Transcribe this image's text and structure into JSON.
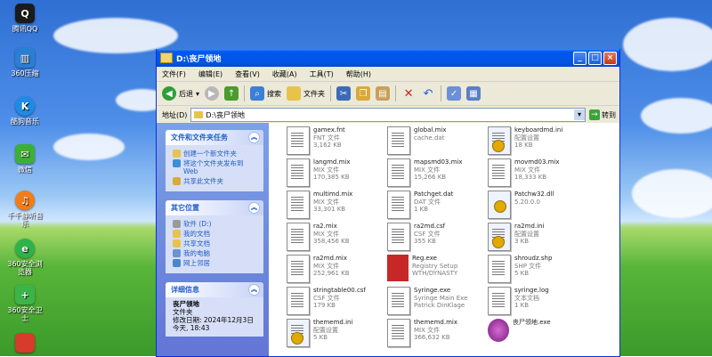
{
  "desktop": {
    "icons": [
      {
        "label": "腾讯QQ",
        "icon": "qq-icon",
        "color": "#1b1b1b"
      },
      {
        "label": "360压缩",
        "icon": "archive-icon",
        "color": "#2a7fd4"
      },
      {
        "label": "酷狗音乐",
        "icon": "music-icon",
        "color": "#1e8be6"
      },
      {
        "label": "微信",
        "icon": "wechat-icon",
        "color": "#3cb034"
      },
      {
        "label": "千千静听音乐",
        "icon": "headphones-icon",
        "color": "#f07d1a"
      },
      {
        "label": "360安全浏览器",
        "icon": "browser-icon",
        "color": "#2fb24a"
      },
      {
        "label": "360安全卫士",
        "icon": "shield-icon",
        "color": "#3bb54a"
      },
      {
        "label": "",
        "icon": "app-icon",
        "color": "#d63b2b"
      }
    ]
  },
  "window": {
    "title": "D:\\丧尸领地",
    "menu": [
      "文件(F)",
      "编辑(E)",
      "查看(V)",
      "收藏(A)",
      "工具(T)",
      "帮助(H)"
    ],
    "toolbar": {
      "back": "后退",
      "search": "搜索",
      "folders": "文件夹"
    },
    "address_label": "地址(D)",
    "address_value": "D:\\丧尸领地",
    "go_label": "转到"
  },
  "tasks": {
    "file_tasks": {
      "title": "文件和文件夹任务",
      "items": [
        "创建一个新文件夹",
        "将这个文件夹发布到 Web",
        "共享此文件夹"
      ]
    },
    "other_places": {
      "title": "其它位置",
      "items": [
        "软件 (D:)",
        "我的文档",
        "共享文档",
        "我的电脑",
        "网上邻居"
      ]
    },
    "details": {
      "title": "详细信息",
      "name": "丧尸领地",
      "type": "文件夹",
      "modified": "修改日期: 2024年12月3日",
      "time": "今天, 18:43"
    }
  },
  "files": [
    {
      "name": "gamex.fnt",
      "type": "FNT 文件",
      "size": "3,162 KB",
      "icon": "document-icon"
    },
    {
      "name": "global.mix",
      "type": "cache.dat",
      "size": "",
      "icon": "document-icon"
    },
    {
      "name": "keyboardmd.ini",
      "type": "配置设置",
      "size": "18 KB",
      "icon": "settings-file-icon"
    },
    {
      "name": "langmd.mix",
      "type": "MIX 文件",
      "size": "170,385 KB",
      "icon": "document-icon"
    },
    {
      "name": "mapsmd03.mix",
      "type": "MIX 文件",
      "size": "15,266 KB",
      "icon": "document-icon"
    },
    {
      "name": "movmd03.mix",
      "type": "MIX 文件",
      "size": "18,333 KB",
      "icon": "document-icon"
    },
    {
      "name": "multimd.mix",
      "type": "MIX 文件",
      "size": "33,301 KB",
      "icon": "document-icon"
    },
    {
      "name": "Patchget.dat",
      "type": "DAT 文件",
      "size": "1 KB",
      "icon": "document-icon"
    },
    {
      "name": "Patchw32.dll",
      "type": "5.20.0.0",
      "size": "",
      "icon": "dll-icon"
    },
    {
      "name": "ra2.mix",
      "type": "MIX 文件",
      "size": "358,456 KB",
      "icon": "document-icon"
    },
    {
      "name": "ra2md.csf",
      "type": "CSF 文件",
      "size": "355 KB",
      "icon": "document-icon"
    },
    {
      "name": "ra2md.ini",
      "type": "配置设置",
      "size": "3 KB",
      "icon": "settings-file-icon"
    },
    {
      "name": "ra2md.mix",
      "type": "MIX 文件",
      "size": "252,961 KB",
      "icon": "document-icon"
    },
    {
      "name": "Reg.exe",
      "type": "Registry Setup",
      "size": "WTH/DYNASTY",
      "icon": "registry-icon"
    },
    {
      "name": "shroudz.shp",
      "type": "SHP 文件",
      "size": "5 KB",
      "icon": "document-icon"
    },
    {
      "name": "stringtable00.csf",
      "type": "CSF 文件",
      "size": "179 KB",
      "icon": "document-icon"
    },
    {
      "name": "Syringe.exe",
      "type": "Syringe Main Exe",
      "size": "Patrick DinKlage",
      "icon": "app-icon"
    },
    {
      "name": "syringe.log",
      "type": "文本文档",
      "size": "1 KB",
      "icon": "document-icon"
    },
    {
      "name": "thememd.ini",
      "type": "配置设置",
      "size": "5 KB",
      "icon": "settings-file-icon"
    },
    {
      "name": "thememd.mix",
      "type": "MIX 文件",
      "size": "366,632 KB",
      "icon": "document-icon"
    },
    {
      "name": "丧尸领地.exe",
      "type": "",
      "size": "",
      "icon": "biohazard-icon"
    }
  ]
}
